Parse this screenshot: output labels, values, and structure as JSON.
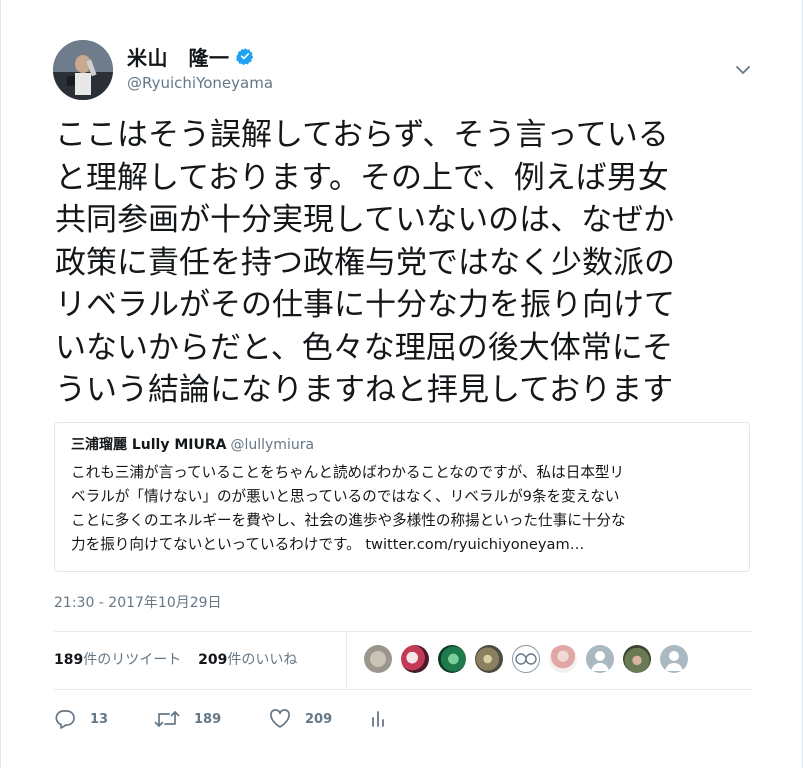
{
  "tweet": {
    "author": {
      "display_name": "米山　隆一",
      "handle": "@RyuichiYoneyama",
      "verified": true
    },
    "text": "ここはそう誤解しておらず、そう言っている\nと理解しております。その上で、例えば男女\n共同参画が十分実現していないのは、なぜか\n政策に責任を持つ政権与党ではなく少数派の\nリベラルがその仕事に十分な力を振り向けて\nいないからだと、色々な理屈の後大体常にそ\nういう結論になりますねと拝見しております",
    "timestamp": "21:30 - 2017年10月29日"
  },
  "quote": {
    "name": "三浦瑠麗 Lully MIURA",
    "handle": "@lullymiura",
    "text": "これも三浦が言っていることをちゃんと読めばわかることなのですが、私は日本型リ\nベラルが「情けない」のが悪いと思っているのではなく、リベラルが9条を変えない\nことに多くのエネルギーを費やし、社会の進歩や多様性の称揚といった仕事に十分な\n力を振り向けてないといっているわけです。 twitter.com/ryuichiyoneyam…"
  },
  "stats": {
    "retweet_count": "189",
    "retweet_label": "件のリツイート",
    "like_count": "209",
    "like_label": "件のいいね"
  },
  "actions": {
    "reply_count": "13",
    "retweet_count": "189",
    "like_count": "209"
  },
  "colors": {
    "text_primary": "#14171a",
    "text_secondary": "#657786",
    "border": "#e1e8ed",
    "verified_blue": "#1da1f2"
  },
  "icons": {
    "caret": "chevron-down-icon",
    "verified": "verified-badge-icon",
    "reply": "reply-icon",
    "retweet": "retweet-icon",
    "like": "heart-icon",
    "analytics": "analytics-icon"
  }
}
